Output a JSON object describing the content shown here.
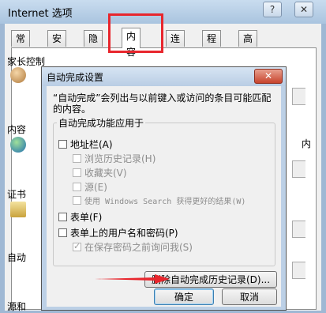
{
  "window": {
    "title": "Internet 选项",
    "help_symbol": "?",
    "close_symbol": "✕"
  },
  "tabs": [
    {
      "label": "常规"
    },
    {
      "label": "安全"
    },
    {
      "label": "隐私"
    },
    {
      "label": "内容",
      "active": true
    },
    {
      "label": "连接"
    },
    {
      "label": "程序"
    },
    {
      "label": "高级"
    }
  ],
  "content_panel": {
    "parental_group": "家长控制",
    "content_group": "内容",
    "content_group_right": "内",
    "cert_group": "证书",
    "autocomplete_group": "自动",
    "feeds_group": "源和"
  },
  "dialog": {
    "title": "自动完成设置",
    "close_symbol": "✕",
    "description": "“自动完成”会列出与以前键入或访问的条目可能匹配的内容。",
    "fieldset_legend": "自动完成功能应用于",
    "options": [
      {
        "label": "地址栏(A)",
        "checked": false,
        "enabled": true
      },
      {
        "label": "浏览历史记录(H)",
        "checked": false,
        "enabled": false
      },
      {
        "label": "收藏夹(V)",
        "checked": false,
        "enabled": false
      },
      {
        "label": "源(E)",
        "checked": false,
        "enabled": false
      },
      {
        "label": "使用 Windows Search 获得更好的结果(W)",
        "checked": false,
        "enabled": false
      },
      {
        "label": "表单(F)",
        "checked": false,
        "enabled": true
      },
      {
        "label": "表单上的用户名和密码(P)",
        "checked": false,
        "enabled": true
      },
      {
        "label": "在保存密码之前询问我(S)",
        "checked": true,
        "enabled": false
      }
    ],
    "delete_history_button": "删除自动完成历史记录(D)...",
    "ok_button": "确定",
    "cancel_button": "取消"
  },
  "colors": {
    "highlight": "#e8262d",
    "arrow": "#e8262d"
  }
}
